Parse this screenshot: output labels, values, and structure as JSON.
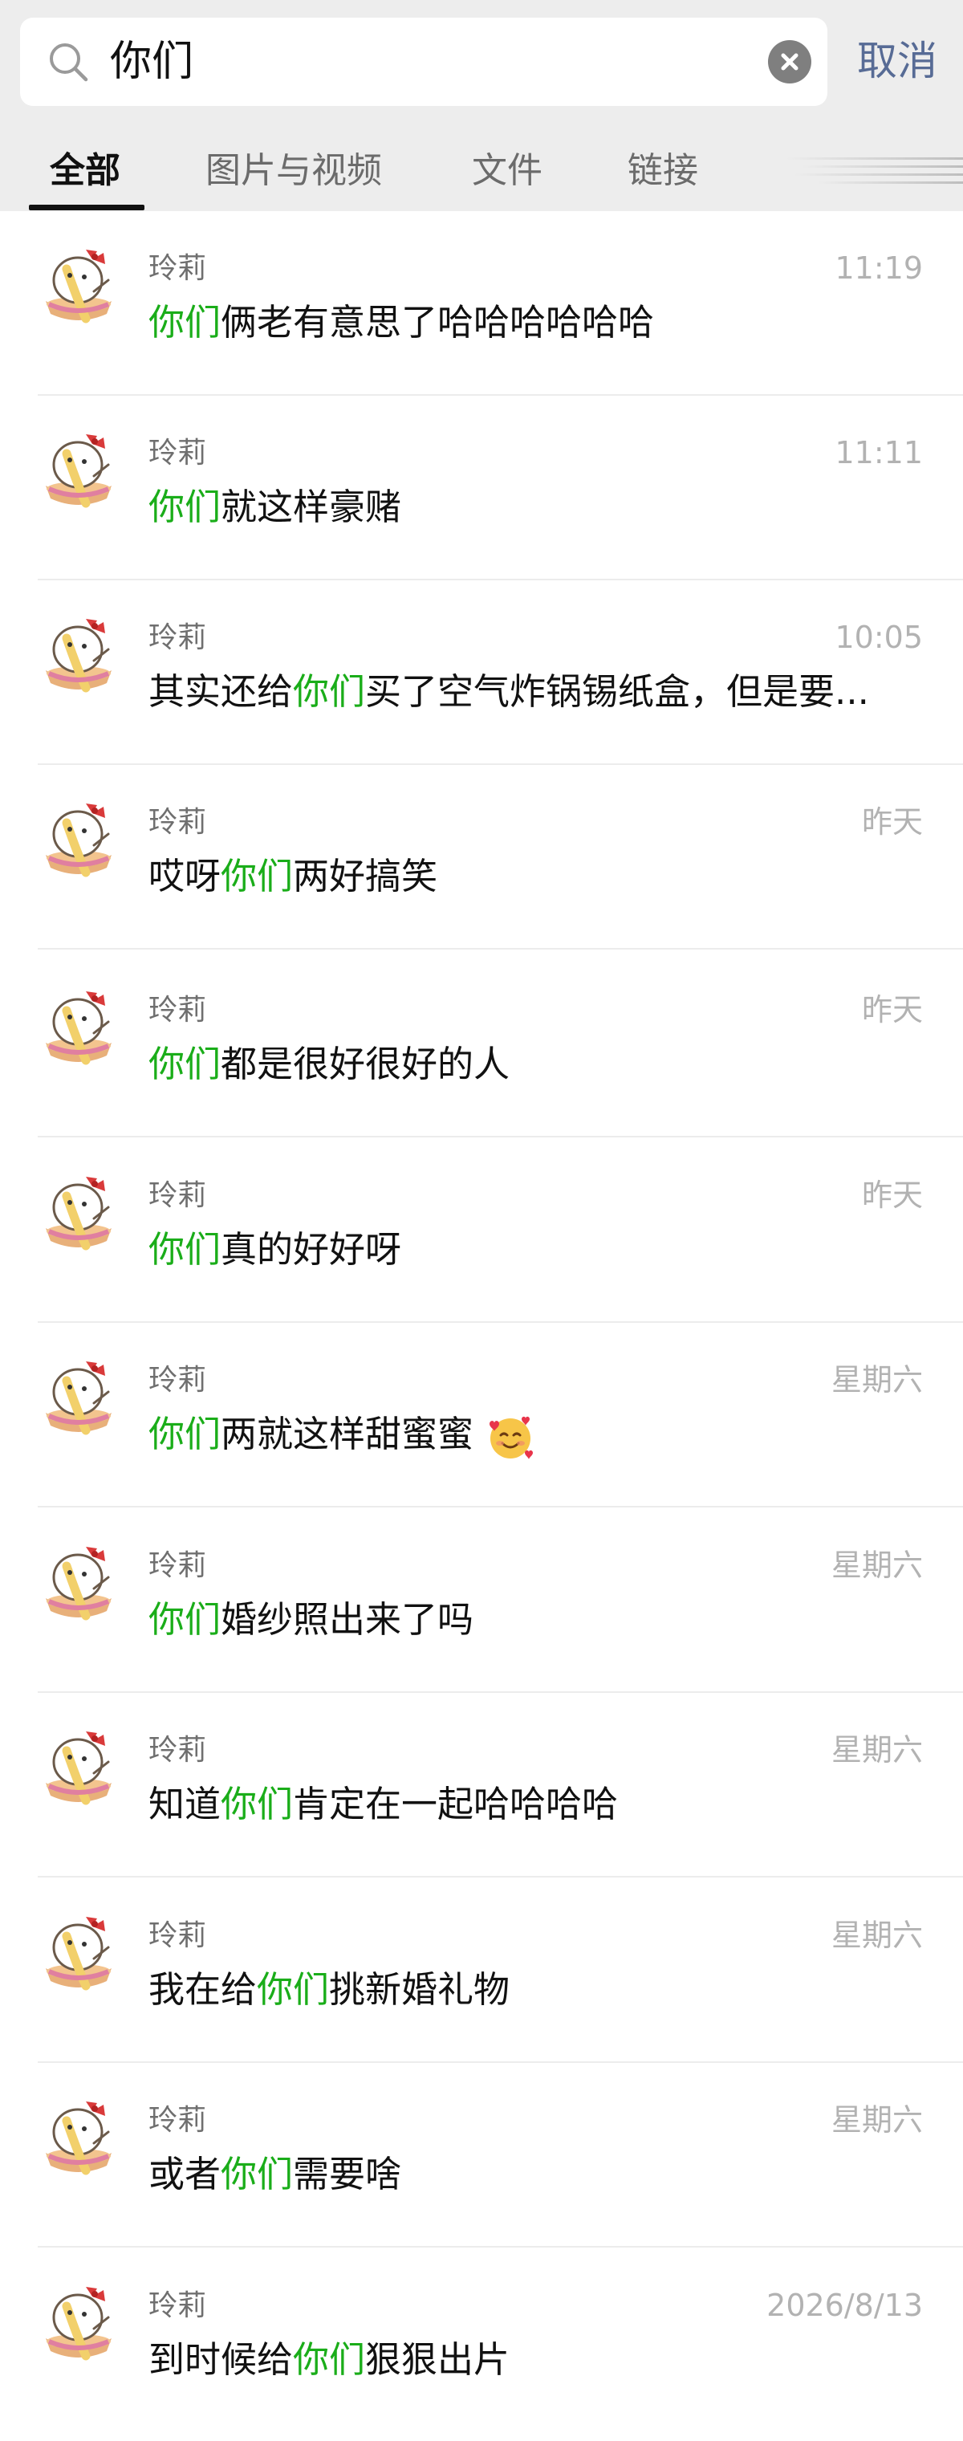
{
  "search": {
    "query": "你们",
    "cancel_label": "取消"
  },
  "tabs": [
    {
      "label": "全部",
      "active": true
    },
    {
      "label": "图片与视频",
      "active": false
    },
    {
      "label": "文件",
      "active": false
    },
    {
      "label": "链接",
      "active": false
    }
  ],
  "colors": {
    "highlight": "#1aad19",
    "cancel": "#576b95",
    "time": "#b2b2b2"
  },
  "results": [
    {
      "sender": "玲莉",
      "time": "11:19",
      "pre": "",
      "hl": "你们",
      "post": "俩老有意思了哈哈哈哈哈哈",
      "emoji": ""
    },
    {
      "sender": "玲莉",
      "time": "11:11",
      "pre": "",
      "hl": "你们",
      "post": "就这样豪赌",
      "emoji": ""
    },
    {
      "sender": "玲莉",
      "time": "10:05",
      "pre": "其实还给",
      "hl": "你们",
      "post": "买了空气炸锅锡纸盒，但是要...",
      "emoji": ""
    },
    {
      "sender": "玲莉",
      "time": "昨天",
      "pre": "哎呀",
      "hl": "你们",
      "post": "两好搞笑",
      "emoji": ""
    },
    {
      "sender": "玲莉",
      "time": "昨天",
      "pre": "",
      "hl": "你们",
      "post": "都是很好很好的人",
      "emoji": ""
    },
    {
      "sender": "玲莉",
      "time": "昨天",
      "pre": "",
      "hl": "你们",
      "post": "真的好好呀",
      "emoji": ""
    },
    {
      "sender": "玲莉",
      "time": "星期六",
      "pre": "",
      "hl": "你们",
      "post": "两就这样甜蜜蜜",
      "emoji": "smiling-face-with-hearts-icon"
    },
    {
      "sender": "玲莉",
      "time": "星期六",
      "pre": "",
      "hl": "你们",
      "post": "婚纱照出来了吗",
      "emoji": ""
    },
    {
      "sender": "玲莉",
      "time": "星期六",
      "pre": "知道",
      "hl": "你们",
      "post": "肯定在一起哈哈哈哈",
      "emoji": ""
    },
    {
      "sender": "玲莉",
      "time": "星期六",
      "pre": "我在给",
      "hl": "你们",
      "post": "挑新婚礼物",
      "emoji": ""
    },
    {
      "sender": "玲莉",
      "time": "星期六",
      "pre": "或者",
      "hl": "你们",
      "post": "需要啥",
      "emoji": ""
    },
    {
      "sender": "玲莉",
      "time": "2026/8/13",
      "pre": "到时候给",
      "hl": "你们",
      "post": "狠狠出片",
      "emoji": ""
    }
  ]
}
